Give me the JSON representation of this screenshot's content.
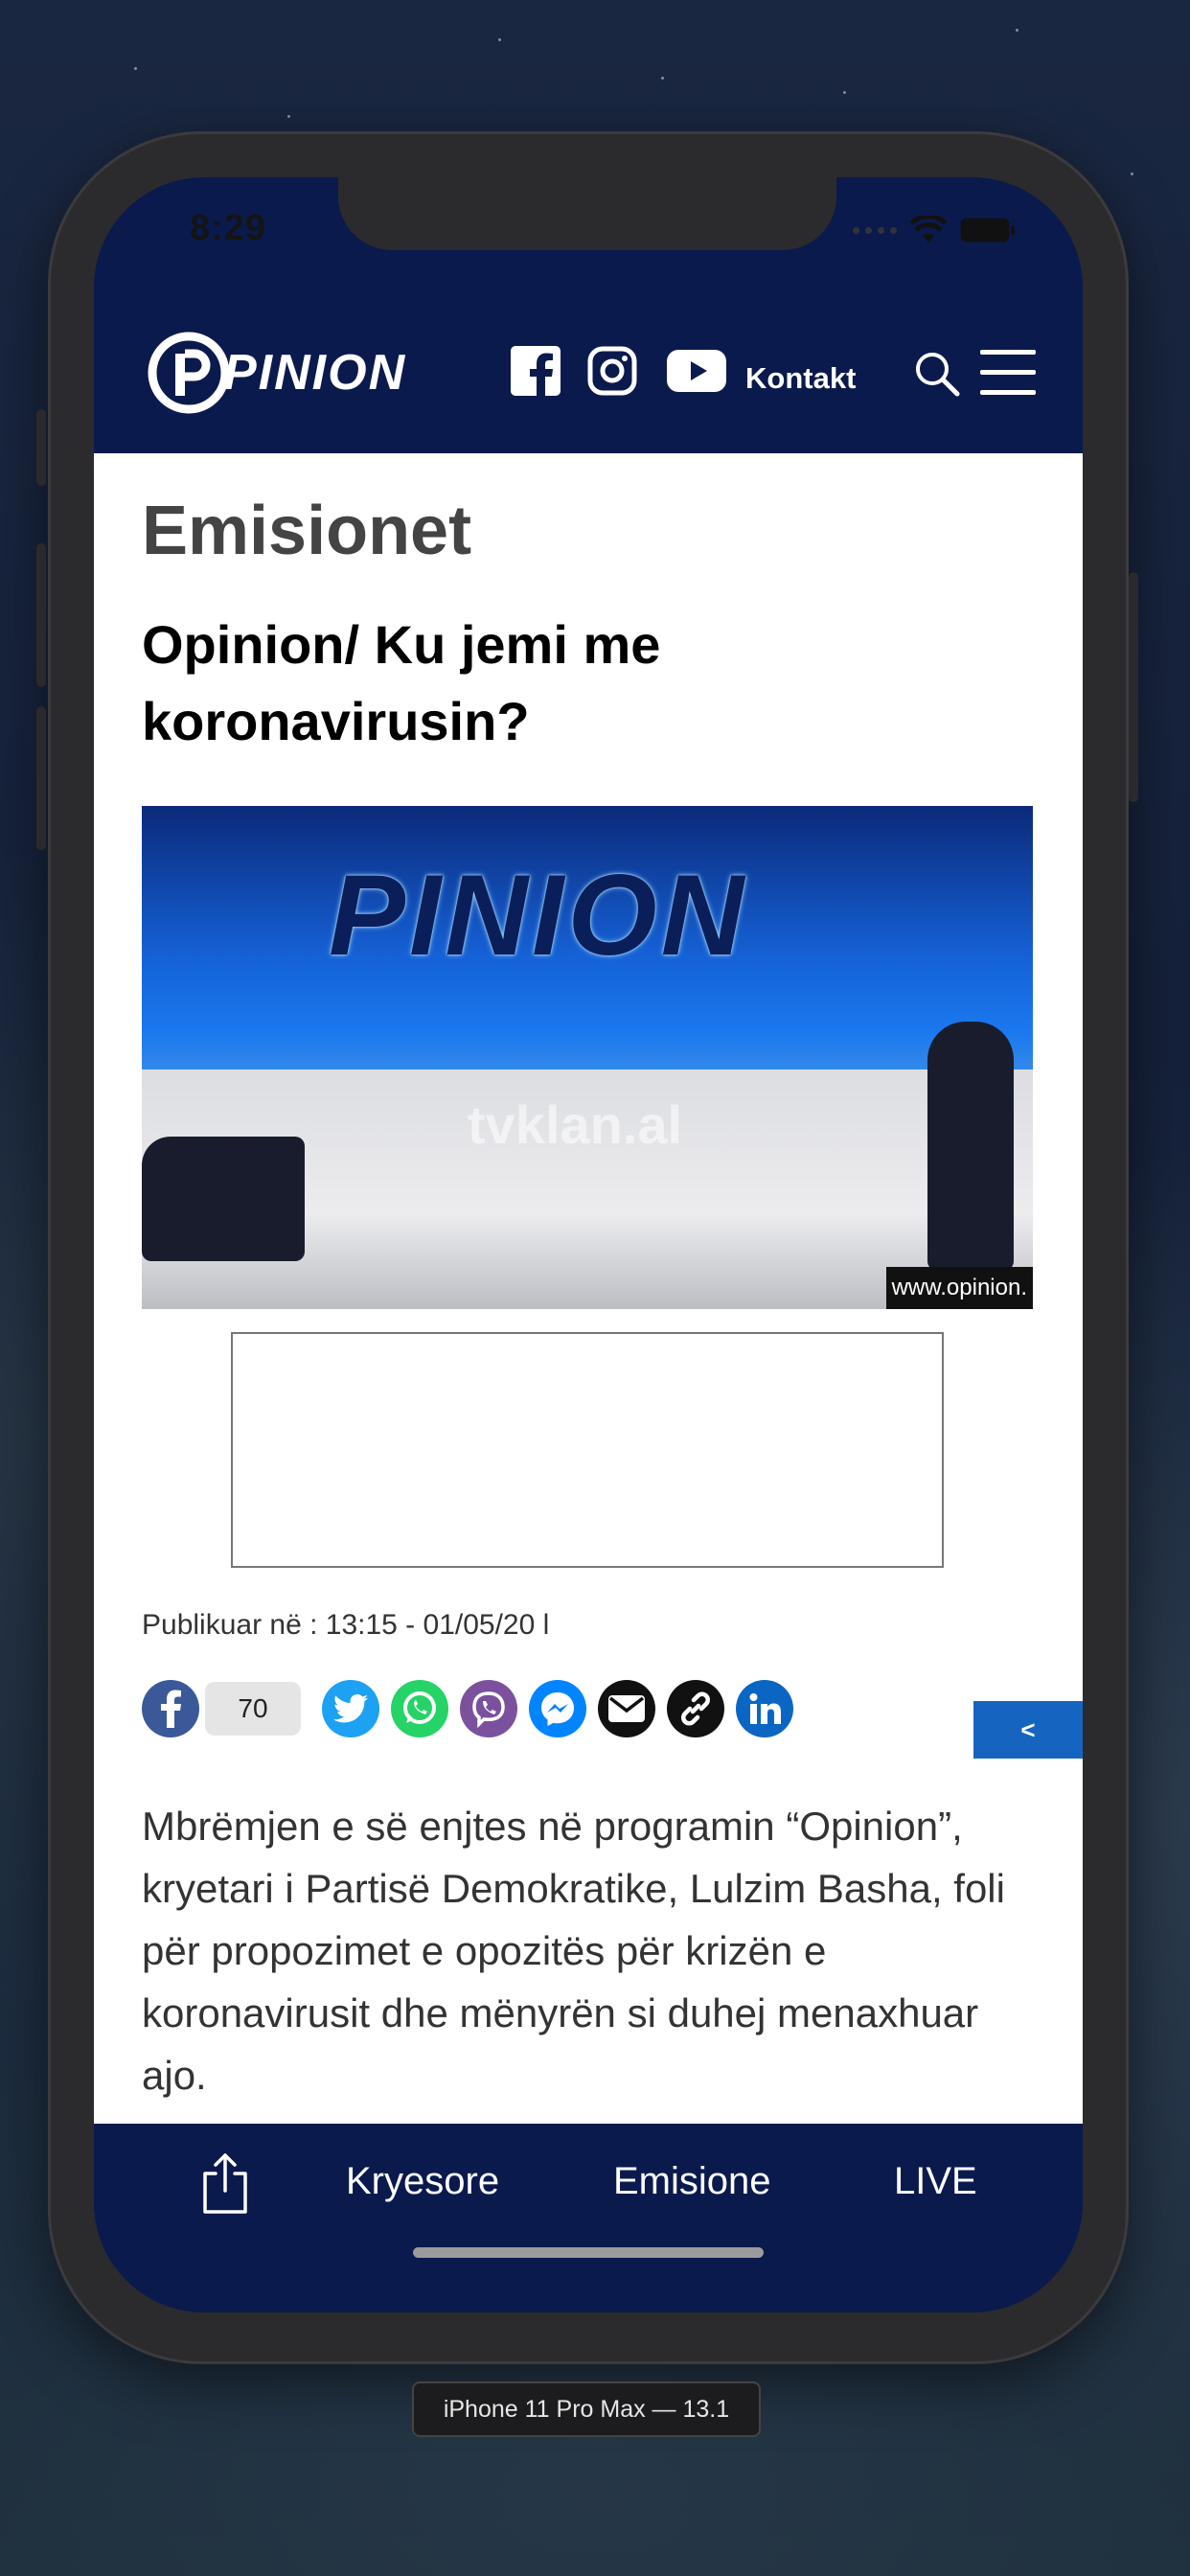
{
  "status_bar": {
    "time": "8:29"
  },
  "header": {
    "logo_text": "PINION",
    "social_icons": [
      "facebook-icon",
      "instagram-icon",
      "youtube-icon"
    ],
    "kontakt_label": "Kontakt"
  },
  "content": {
    "section_title": "Emisionet",
    "article_title": "Opinion/ Ku jemi me koronavirusin?",
    "hero": {
      "logo_text": "PINION",
      "watermark": "tvklan.al",
      "url": "www.opinion."
    },
    "published": "Publikuar në : 13:15 - 01/05/20 l",
    "share": {
      "facebook_count": "70",
      "icons": [
        "facebook-icon",
        "twitter-icon",
        "whatsapp-icon",
        "viber-icon",
        "messenger-icon",
        "email-icon",
        "link-icon",
        "linkedin-icon"
      ],
      "tab_label": "<"
    },
    "body": "Mbrëmjen e së enjtes në programin “Opinion”, kryetari i Partisë Demokratike, Lulzim Basha, foli për propozimet e opozitës për krizën e koronavirusit dhe mënyrën si duhej menaxhuar ajo."
  },
  "bottom_nav": {
    "items": [
      {
        "label": "Kryesore"
      },
      {
        "label": "Emisione"
      },
      {
        "label": "LIVE"
      }
    ]
  },
  "simulator": {
    "device_label": "iPhone 11 Pro Max — 13.1"
  },
  "colors": {
    "navy": "#0b1a4d",
    "accent_blue": "#1565c0",
    "facebook": "#3b5998",
    "twitter": "#1da1f2",
    "whatsapp": "#25d366",
    "viber": "#7b519d",
    "messenger": "#0084ff",
    "linkedin": "#0a66c2"
  }
}
